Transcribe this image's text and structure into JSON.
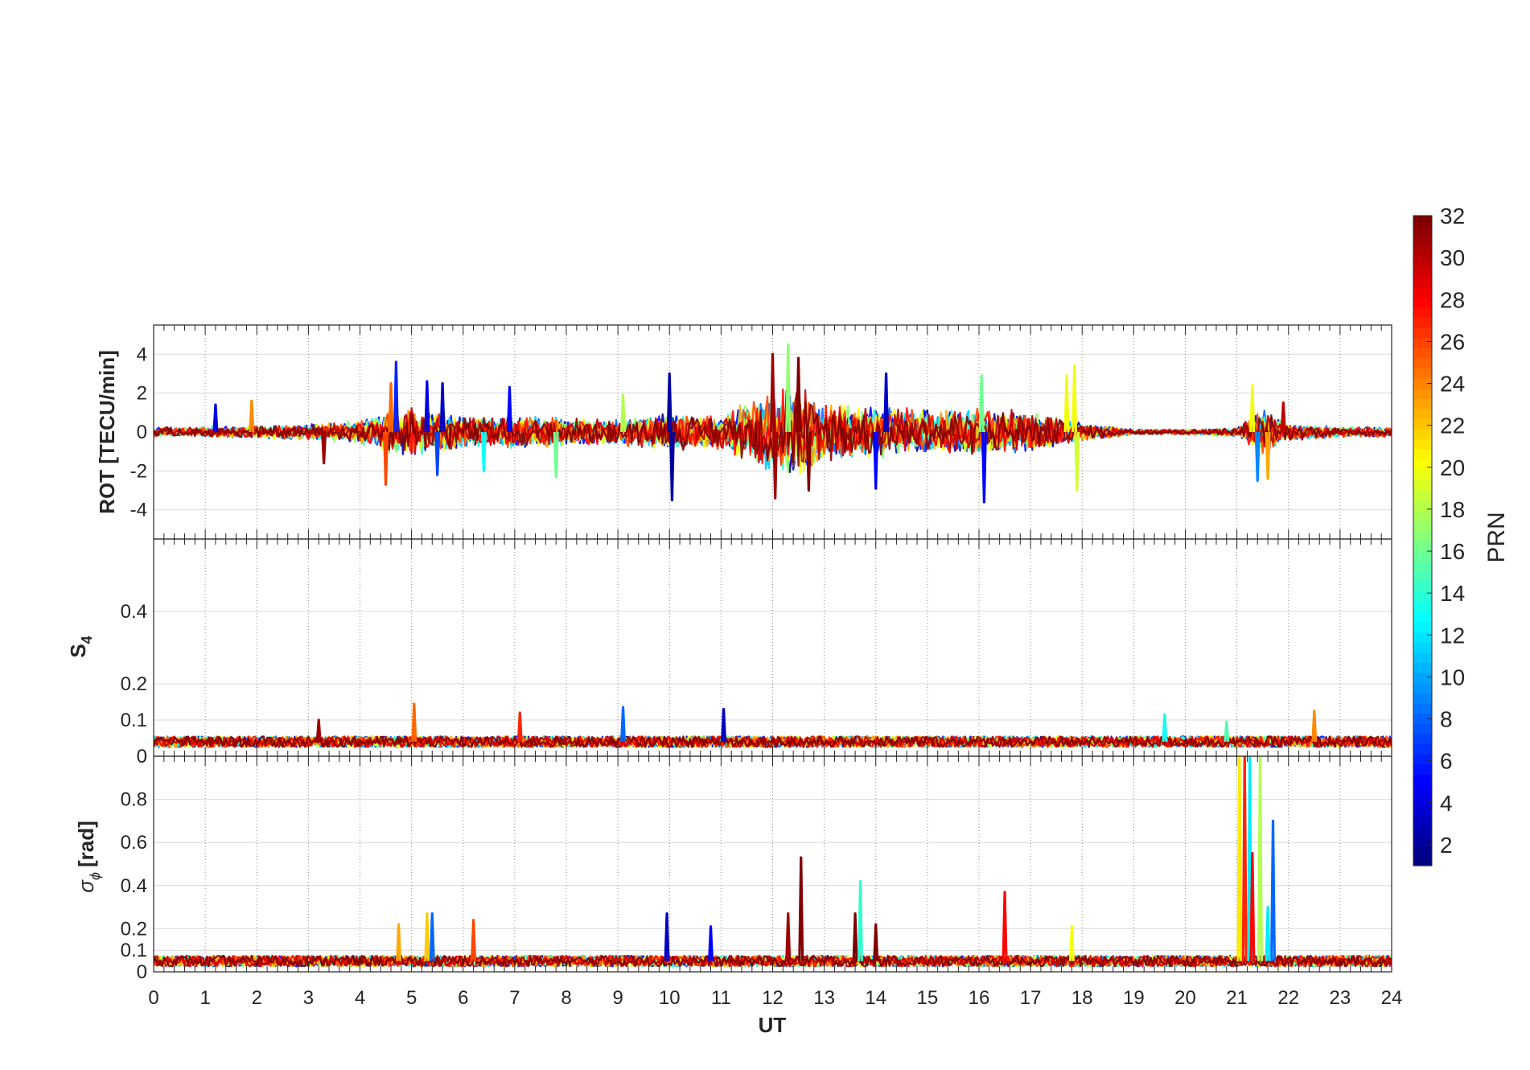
{
  "chart_data": [
    {
      "type": "line",
      "panel": "rot",
      "ylabel": "ROT [TECU/min]",
      "ylim": [
        -5.5,
        5.5
      ],
      "yticks": [
        -4,
        -2,
        0,
        2,
        4
      ],
      "xlim": [
        0,
        24
      ],
      "grid": true,
      "series_note": "one colored trace per GPS PRN, colored by PRN",
      "noise_envelope": {
        "hours": [
          0,
          1,
          2,
          3,
          4,
          4.5,
          5,
          5.5,
          6,
          7,
          8,
          9,
          10,
          11,
          12,
          12.5,
          13,
          14,
          15,
          16,
          17,
          18,
          19,
          20,
          21,
          21.5,
          22,
          23,
          24
        ],
        "amplitude": [
          0.25,
          0.3,
          0.35,
          0.45,
          0.6,
          1.2,
          1.3,
          1.1,
          0.9,
          0.9,
          0.8,
          0.7,
          1.0,
          0.9,
          2.2,
          2.4,
          1.6,
          1.4,
          1.2,
          1.3,
          1.1,
          0.5,
          0.15,
          0.15,
          0.25,
          1.2,
          0.5,
          0.3,
          0.3
        ]
      },
      "spikes": [
        {
          "hour": 1.2,
          "value": 1.4,
          "prn": 4
        },
        {
          "hour": 1.9,
          "value": 1.6,
          "prn": 24
        },
        {
          "hour": 3.3,
          "value": -1.6,
          "prn": 31
        },
        {
          "hour": 4.5,
          "value": -2.7,
          "prn": 26
        },
        {
          "hour": 4.6,
          "value": 2.5,
          "prn": 25
        },
        {
          "hour": 4.7,
          "value": 3.6,
          "prn": 6
        },
        {
          "hour": 5.3,
          "value": 2.6,
          "prn": 4
        },
        {
          "hour": 5.5,
          "value": -2.2,
          "prn": 7
        },
        {
          "hour": 5.6,
          "value": 2.5,
          "prn": 3
        },
        {
          "hour": 6.4,
          "value": -2.0,
          "prn": 13
        },
        {
          "hour": 6.9,
          "value": 2.3,
          "prn": 5
        },
        {
          "hour": 7.8,
          "value": -2.3,
          "prn": 16
        },
        {
          "hour": 9.1,
          "value": 1.9,
          "prn": 18
        },
        {
          "hour": 10.0,
          "value": 3.0,
          "prn": 2
        },
        {
          "hour": 10.05,
          "value": -3.5,
          "prn": 2
        },
        {
          "hour": 12.0,
          "value": 4.0,
          "prn": 31
        },
        {
          "hour": 12.05,
          "value": -3.4,
          "prn": 31
        },
        {
          "hour": 12.3,
          "value": 4.5,
          "prn": 17
        },
        {
          "hour": 12.5,
          "value": 3.8,
          "prn": 32
        },
        {
          "hour": 12.7,
          "value": -3.0,
          "prn": 32
        },
        {
          "hour": 14.2,
          "value": 3.0,
          "prn": 3
        },
        {
          "hour": 14.0,
          "value": -2.9,
          "prn": 5
        },
        {
          "hour": 16.05,
          "value": 2.9,
          "prn": 16
        },
        {
          "hour": 16.1,
          "value": -3.6,
          "prn": 5
        },
        {
          "hour": 17.7,
          "value": 2.9,
          "prn": 20
        },
        {
          "hour": 17.85,
          "value": 3.4,
          "prn": 20
        },
        {
          "hour": 17.9,
          "value": -3.0,
          "prn": 19
        },
        {
          "hour": 21.3,
          "value": 2.4,
          "prn": 20
        },
        {
          "hour": 21.4,
          "value": -2.5,
          "prn": 9
        },
        {
          "hour": 21.6,
          "value": -2.4,
          "prn": 23
        },
        {
          "hour": 21.9,
          "value": 1.5,
          "prn": 30
        }
      ]
    },
    {
      "type": "line",
      "panel": "s4",
      "ylabel": "S4",
      "ylabel_main": "S",
      "ylabel_sub": "4",
      "ylim": [
        0,
        0.6
      ],
      "yticks": [
        0,
        0.1,
        0.2,
        0.4
      ],
      "xlim": [
        0,
        24
      ],
      "grid": true,
      "baseline": 0.04,
      "noise_amplitude": 0.015,
      "spikes": [
        {
          "hour": 3.2,
          "value": 0.1,
          "prn": 31
        },
        {
          "hour": 5.05,
          "value": 0.145,
          "prn": 25
        },
        {
          "hour": 7.1,
          "value": 0.12,
          "prn": 27
        },
        {
          "hour": 9.1,
          "value": 0.135,
          "prn": 8
        },
        {
          "hour": 11.05,
          "value": 0.13,
          "prn": 3
        },
        {
          "hour": 19.6,
          "value": 0.115,
          "prn": 13
        },
        {
          "hour": 20.8,
          "value": 0.095,
          "prn": 15
        },
        {
          "hour": 22.5,
          "value": 0.125,
          "prn": 24
        }
      ]
    },
    {
      "type": "line",
      "panel": "sigma_phi",
      "ylabel": "σφ [rad]",
      "ylabel_main": "σ",
      "ylabel_sub": "ϕ",
      "ylabel_unit": "[rad]",
      "ylim": [
        0,
        1.0
      ],
      "yticks": [
        0,
        0.1,
        0.2,
        0.4,
        0.6,
        0.8
      ],
      "xlim": [
        0,
        24
      ],
      "grid": true,
      "baseline": 0.05,
      "noise_amplitude": 0.025,
      "spikes": [
        {
          "hour": 4.75,
          "value": 0.22,
          "prn": 23
        },
        {
          "hour": 5.3,
          "value": 0.27,
          "prn": 22
        },
        {
          "hour": 5.4,
          "value": 0.27,
          "prn": 8
        },
        {
          "hour": 6.2,
          "value": 0.24,
          "prn": 26
        },
        {
          "hour": 9.95,
          "value": 0.27,
          "prn": 3
        },
        {
          "hour": 10.8,
          "value": 0.21,
          "prn": 5
        },
        {
          "hour": 12.3,
          "value": 0.27,
          "prn": 31
        },
        {
          "hour": 12.55,
          "value": 0.53,
          "prn": 32
        },
        {
          "hour": 13.6,
          "value": 0.27,
          "prn": 32
        },
        {
          "hour": 13.7,
          "value": 0.42,
          "prn": 14
        },
        {
          "hour": 14.0,
          "value": 0.22,
          "prn": 32
        },
        {
          "hour": 16.5,
          "value": 0.37,
          "prn": 28
        },
        {
          "hour": 17.8,
          "value": 0.21,
          "prn": 20
        },
        {
          "hour": 21.05,
          "value": 1.0,
          "prn": 21
        },
        {
          "hour": 21.15,
          "value": 1.0,
          "prn": 27
        },
        {
          "hour": 21.25,
          "value": 1.0,
          "prn": 12
        },
        {
          "hour": 21.45,
          "value": 1.0,
          "prn": 18
        },
        {
          "hour": 21.3,
          "value": 0.55,
          "prn": 28
        },
        {
          "hour": 21.7,
          "value": 0.7,
          "prn": 8
        },
        {
          "hour": 21.6,
          "value": 0.3,
          "prn": 12
        }
      ]
    }
  ],
  "xaxis": {
    "label": "UT",
    "ticks": [
      "0",
      "1",
      "2",
      "3",
      "4",
      "5",
      "6",
      "7",
      "8",
      "9",
      "10",
      "11",
      "12",
      "13",
      "14",
      "15",
      "16",
      "17",
      "18",
      "19",
      "20",
      "21",
      "22",
      "23",
      "24"
    ]
  },
  "colorbar": {
    "label": "PRN",
    "range": [
      1,
      32
    ],
    "ticks": [
      "2",
      "4",
      "6",
      "8",
      "10",
      "12",
      "14",
      "16",
      "18",
      "20",
      "22",
      "24",
      "26",
      "28",
      "30",
      "32"
    ],
    "colormap": "jet"
  },
  "colors": {
    "grid": "#d9d9d9",
    "vgrid": "#8c8c8c",
    "axis": "#262626"
  }
}
